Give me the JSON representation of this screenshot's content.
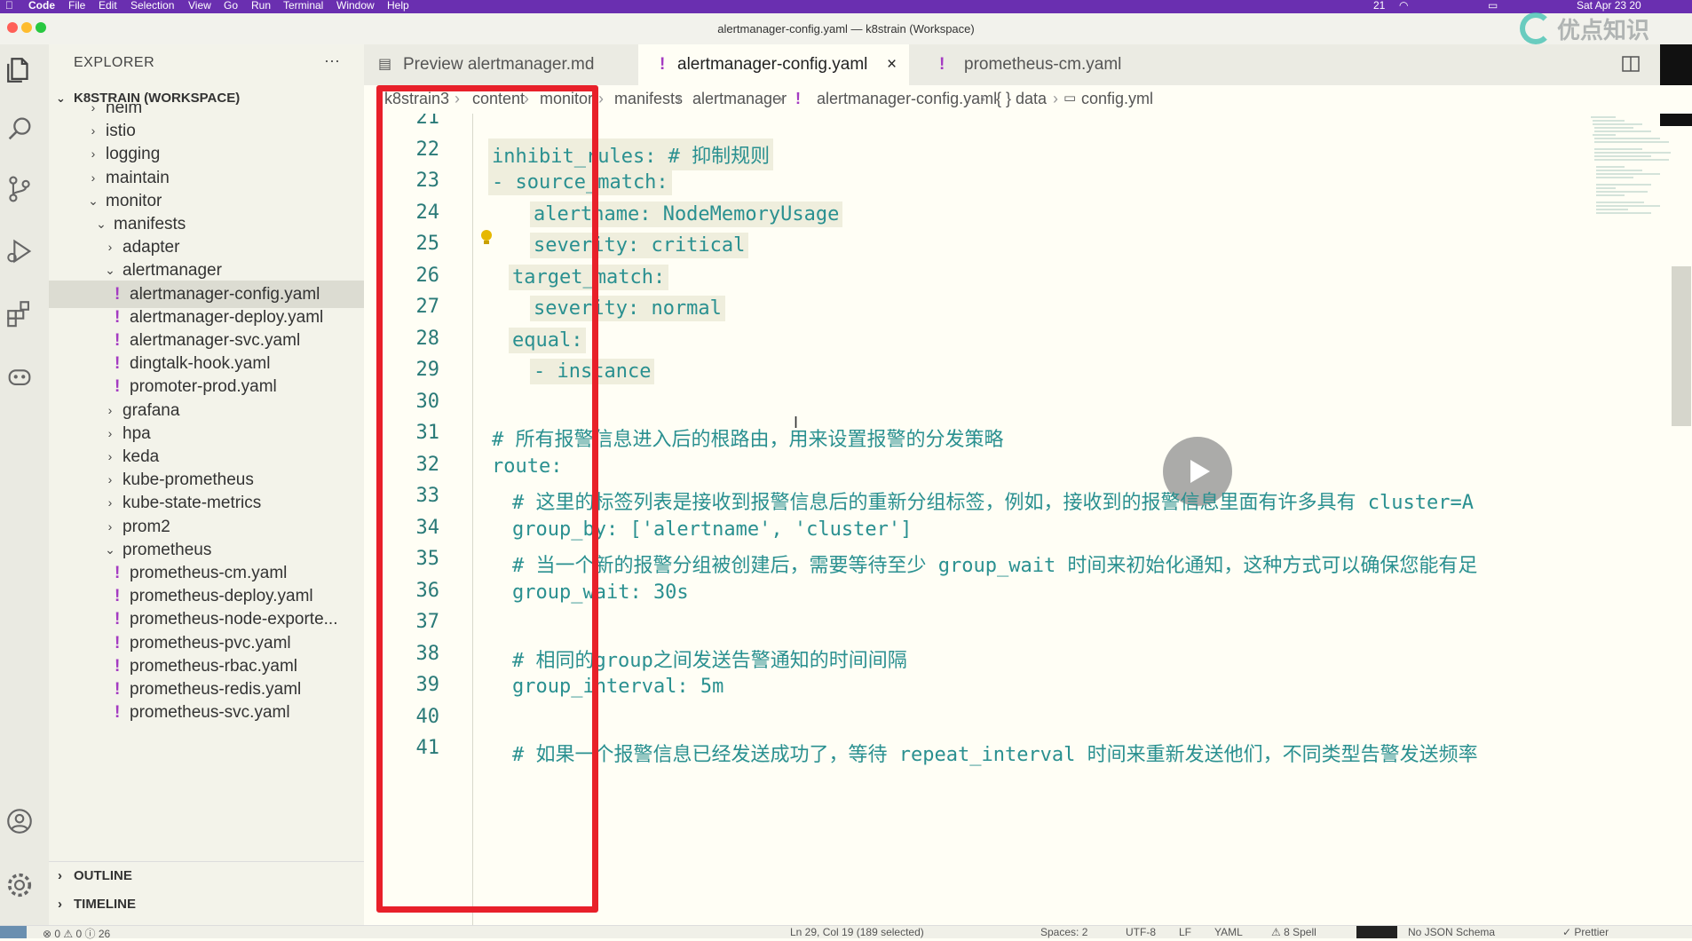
{
  "menubar": {
    "app": "Code",
    "items": [
      "File",
      "Edit",
      "Selection",
      "View",
      "Go",
      "Run",
      "Terminal",
      "Window",
      "Help"
    ],
    "right": [
      "21",
      "Sat Apr 23 20"
    ],
    "watermark": "优点知识"
  },
  "window": {
    "title": "alertmanager-config.yaml — k8strain (Workspace)"
  },
  "sidebar": {
    "header": "EXPLORER",
    "more": "···",
    "workspace": "K8STRAIN (WORKSPACE)",
    "tree": [
      {
        "label": "helm",
        "type": "folder"
      },
      {
        "label": "istio",
        "type": "folder"
      },
      {
        "label": "logging",
        "type": "folder"
      },
      {
        "label": "maintain",
        "type": "folder"
      },
      {
        "label": "monitor",
        "type": "folder-open"
      },
      {
        "label": "manifests",
        "type": "folder-open"
      },
      {
        "label": "adapter",
        "type": "folder"
      },
      {
        "label": "alertmanager",
        "type": "folder-open"
      },
      {
        "label": "alertmanager-config.yaml",
        "type": "file",
        "selected": true
      },
      {
        "label": "alertmanager-deploy.yaml",
        "type": "file"
      },
      {
        "label": "alertmanager-svc.yaml",
        "type": "file"
      },
      {
        "label": "dingtalk-hook.yaml",
        "type": "file"
      },
      {
        "label": "promoter-prod.yaml",
        "type": "file"
      },
      {
        "label": "grafana",
        "type": "folder"
      },
      {
        "label": "hpa",
        "type": "folder"
      },
      {
        "label": "keda",
        "type": "folder"
      },
      {
        "label": "kube-prometheus",
        "type": "folder"
      },
      {
        "label": "kube-state-metrics",
        "type": "folder"
      },
      {
        "label": "prom2",
        "type": "folder"
      },
      {
        "label": "prometheus",
        "type": "folder-open"
      },
      {
        "label": "prometheus-cm.yaml",
        "type": "file"
      },
      {
        "label": "prometheus-deploy.yaml",
        "type": "file"
      },
      {
        "label": "prometheus-node-exporte...",
        "type": "file"
      },
      {
        "label": "prometheus-pvc.yaml",
        "type": "file"
      },
      {
        "label": "prometheus-rbac.yaml",
        "type": "file"
      },
      {
        "label": "prometheus-redis.yaml",
        "type": "file"
      },
      {
        "label": "prometheus-svc.yaml",
        "type": "file"
      }
    ],
    "outline": "OUTLINE",
    "timeline": "TIMELINE"
  },
  "tabs": [
    {
      "label": "Preview alertmanager.md",
      "active": false
    },
    {
      "label": "alertmanager-config.yaml",
      "active": true,
      "close": "×"
    },
    {
      "label": "prometheus-cm.yaml",
      "active": false
    }
  ],
  "breadcrumb": [
    "k8strain3",
    "content",
    "monitor",
    "manifests",
    "alertmanager",
    "alertmanager-config.yaml",
    "{ } data",
    "config.yml"
  ],
  "editor": {
    "lines": [
      {
        "n": "21",
        "text": ""
      },
      {
        "n": "22",
        "text": "inhibit_rules: # 抑制规则"
      },
      {
        "n": "23",
        "text": "- source_match:"
      },
      {
        "n": "24",
        "text": "alertname: NodeMemoryUsage"
      },
      {
        "n": "25",
        "text": "severity: critical"
      },
      {
        "n": "26",
        "text": "target_match:"
      },
      {
        "n": "27",
        "text": "severity: normal"
      },
      {
        "n": "28",
        "text": "equal:"
      },
      {
        "n": "29",
        "text": "- instance"
      },
      {
        "n": "30",
        "text": ""
      },
      {
        "n": "31",
        "text": "# 所有报警信息进入后的根路由，用来设置报警的分发策略"
      },
      {
        "n": "32",
        "text": "route:"
      },
      {
        "n": "33",
        "text": "# 这里的标签列表是接收到报警信息后的重新分组标签，例如，接收到的报警信息里面有许多具有 cluster=A"
      },
      {
        "n": "34",
        "text": "group_by: ['alertname', 'cluster']"
      },
      {
        "n": "35",
        "text": "# 当一个新的报警分组被创建后，需要等待至少 group_wait 时间来初始化通知，这种方式可以确保您能有足"
      },
      {
        "n": "36",
        "text": "group_wait: 30s"
      },
      {
        "n": "37",
        "text": ""
      },
      {
        "n": "38",
        "text": "# 相同的group之间发送告警通知的时间间隔"
      },
      {
        "n": "39",
        "text": "group_interval: 5m"
      },
      {
        "n": "40",
        "text": ""
      },
      {
        "n": "41",
        "text": "# 如果一个报警信息已经发送成功了，等待 repeat_interval 时间来重新发送他们，不同类型告警发送频率"
      }
    ]
  },
  "statusbar": {
    "problems": "⊗ 0 ⚠ 0 ⓘ 26",
    "position": "Ln 29, Col 19 (189 selected)",
    "spaces": "Spaces: 2",
    "encoding": "UTF-8",
    "eol": "LF",
    "language": "YAML",
    "spell": "⚠ 8 Spell",
    "schema": "No JSON Schema",
    "prettier": "✓ Prettier"
  },
  "colors": {
    "menubar": "#6a2fb0",
    "code": "#2a9090",
    "line_numbers": "#2a7a78",
    "highlight": "#e8202a",
    "yaml_file_icon": "#a43bc2"
  }
}
